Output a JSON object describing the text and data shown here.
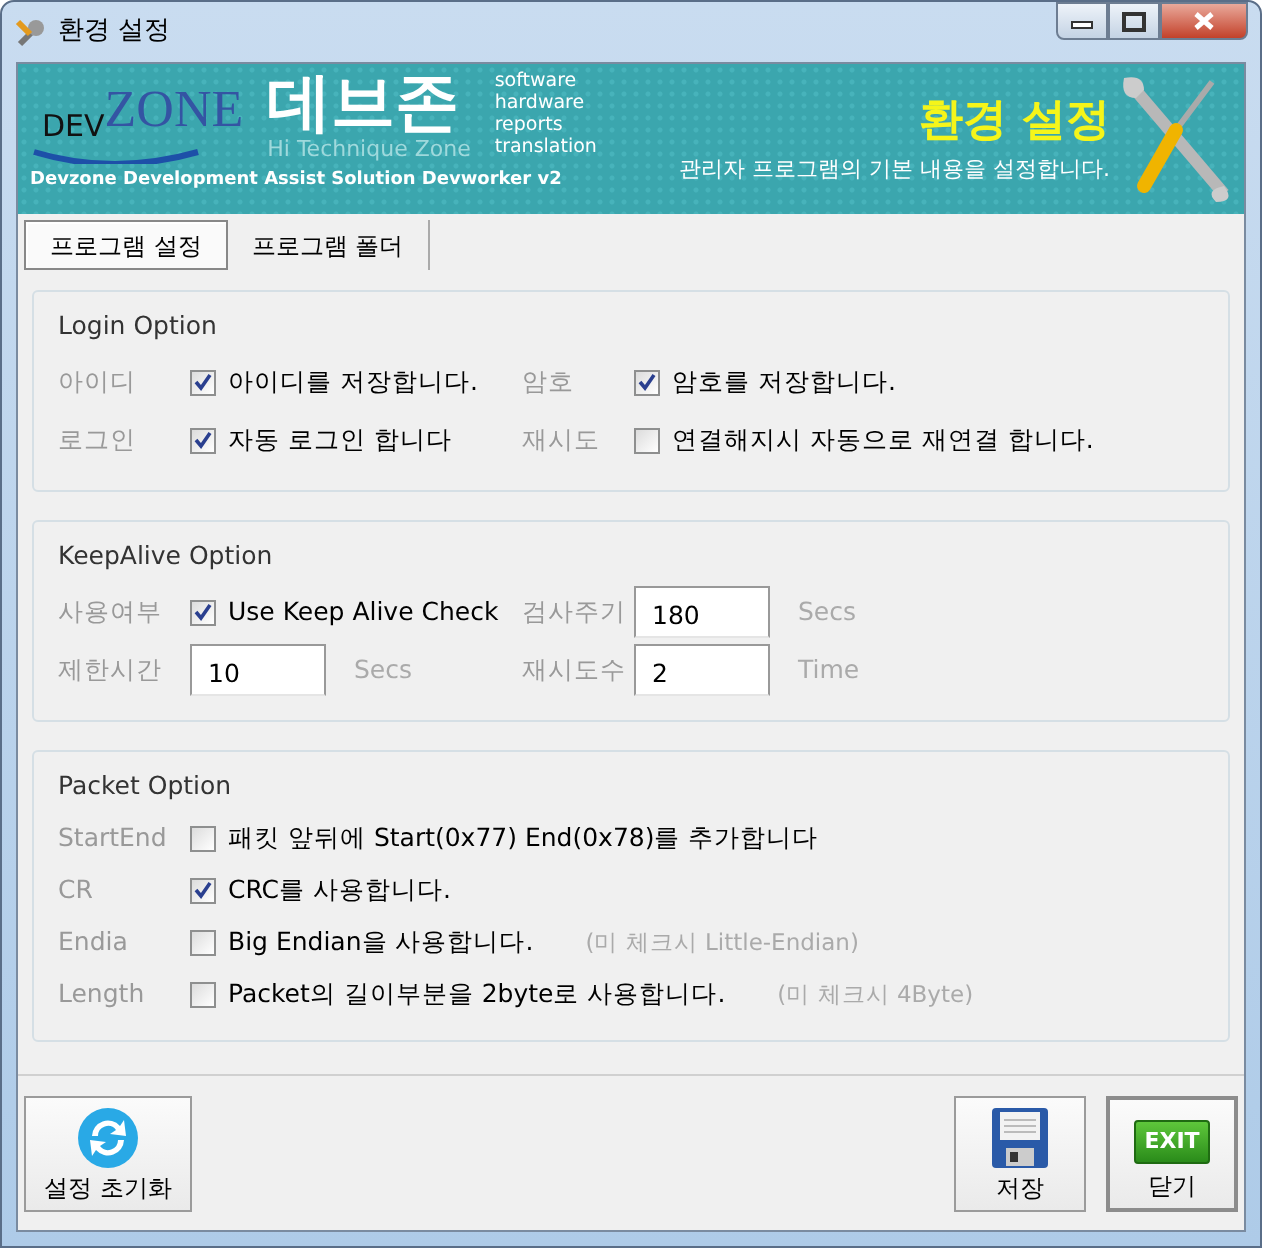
{
  "window": {
    "title": "환경 설정"
  },
  "banner": {
    "logo_prefix": "DEV",
    "logo_main": "ZONE",
    "brand": "데브존",
    "brand_sub": "Hi Technique Zone",
    "keywords": [
      "software",
      "hardware",
      "reports",
      "translation"
    ],
    "product": "Devzone Development Assist Solution Devworker v2",
    "heading": "환경 설정",
    "description": "관리자 프로그램의 기본 내용을 설정합니다."
  },
  "tabs": [
    {
      "label": "프로그램 설정",
      "selected": true
    },
    {
      "label": "프로그램 폴더",
      "selected": false
    }
  ],
  "groups": [
    {
      "title": "Login Option",
      "rows": [
        [
          {
            "label": "아이디",
            "kind": "checkbox",
            "text": "아이디를 저장합니다.",
            "checked": true
          },
          {
            "label": "암호",
            "kind": "checkbox",
            "text": "암호를 저장합니다.",
            "checked": true
          }
        ],
        [
          {
            "label": "로그인",
            "kind": "checkbox",
            "text": "자동 로그인 합니다",
            "checked": true
          },
          {
            "label": "재시도",
            "kind": "checkbox",
            "text": "연결해지시 자동으로 재연결 합니다.",
            "checked": false
          }
        ]
      ]
    },
    {
      "title": "KeepAlive Option",
      "rows": [
        [
          {
            "label": "사용여부",
            "kind": "checkbox",
            "text": "Use Keep Alive Check",
            "checked": true
          },
          {
            "label": "검사주기",
            "kind": "input",
            "value": "180",
            "unit": "Secs"
          }
        ],
        [
          {
            "label": "제한시간",
            "kind": "input",
            "value": "10",
            "unit": "Secs"
          },
          {
            "label": "재시도수",
            "kind": "input",
            "value": "2",
            "unit": "Time"
          }
        ]
      ]
    },
    {
      "title": "Packet Option",
      "rows": [
        [
          {
            "label": "StartEnd",
            "kind": "checkbox",
            "text": "패킷 앞뒤에 Start(0x77) End(0x78)를 추가합니다",
            "checked": false
          }
        ],
        [
          {
            "label": "CR",
            "kind": "checkbox",
            "text": "CRC를 사용합니다.",
            "checked": true
          }
        ],
        [
          {
            "label": "Endia",
            "kind": "checkbox",
            "text": "Big Endian을 사용합니다.",
            "checked": false,
            "note": "(미 체크시 Little-Endian)"
          }
        ],
        [
          {
            "label": "Length",
            "kind": "checkbox",
            "text": "Packet의 길이부분을 2byte로 사용합니다.",
            "checked": false,
            "note": "(미 체크시 4Byte)"
          }
        ]
      ]
    }
  ],
  "buttons": [
    {
      "kind": "reset",
      "label": "설정 초기화"
    },
    {
      "kind": "save",
      "label": "저장"
    },
    {
      "kind": "exit",
      "label": "닫기",
      "badge": "EXIT"
    }
  ]
}
